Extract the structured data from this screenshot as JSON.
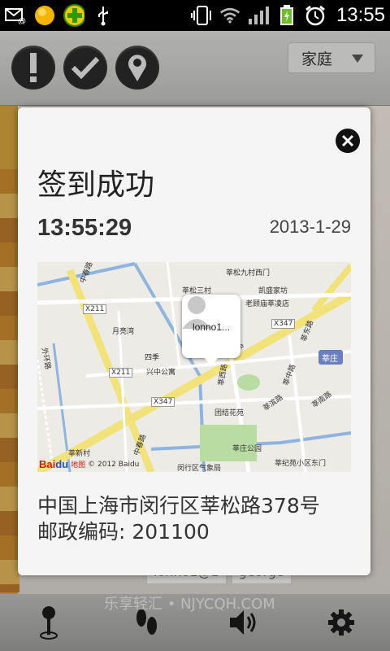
{
  "status_bar": {
    "time": "13:55",
    "left_icons": [
      "email-alert-icon",
      "sun-app-icon",
      "plus-app-icon",
      "usb-icon"
    ],
    "right_icons": [
      "vibrate-icon",
      "wifi-icon",
      "signal-icon",
      "battery-charging-icon",
      "alarm-icon"
    ]
  },
  "toolbar": {
    "buttons": [
      "alert-icon",
      "checkmark-icon",
      "location-pin-icon"
    ],
    "family_select": "家庭"
  },
  "background_partial_text": [
    "lonno1@1",
    "george"
  ],
  "tabbar": {
    "icons": [
      "map-pin-tab-icon",
      "footprints-tab-icon",
      "speaker-tab-icon",
      "gear-tab-icon"
    ]
  },
  "watermark": "乐享轻汇 • NJYCQH.COM",
  "dialog": {
    "title": "签到成功",
    "time": "13:55:29",
    "date": "2013-1-29",
    "map": {
      "pin_label": "lonno1...",
      "labels": {
        "zhongchun_top": "中春路",
        "xinsong3": "莘松三村",
        "xinsong9": "莘松九村西门",
        "kaiyuan": "凯盛家坊",
        "laoyang": "老顾庙莘凌店",
        "x211a": "X211",
        "yueliang": "月亮湾",
        "x347a": "X347",
        "xindong": "莘东路",
        "waihuan": "外环路",
        "siji": "四季",
        "xinsong_road": "莘松路",
        "x211b": "X211",
        "xingzhong": "兴中公寓",
        "xinxi": "莘西路",
        "xinzhong": "莘中路",
        "xinzhuang": "莘庄",
        "x347b": "X347",
        "tuanjie": "团结花苑",
        "xinbin": "莘滨路",
        "xinnan": "莘南路",
        "zhongchun_bottom": "中春路",
        "xinzhuang_park": "莘庄公园",
        "xinxincun": "莘新村",
        "minhang_qx": "闵行区气象局",
        "xinjishao": "莘纪苑小区东门",
        "copyright": "© 2012 Baidu",
        "logo_bai": "Bai",
        "logo_du": "du",
        "logo_ditu": "地图"
      }
    },
    "address_line1": "中国上海市闵行区莘松路378号",
    "address_line2": "邮政编码: 201100"
  }
}
